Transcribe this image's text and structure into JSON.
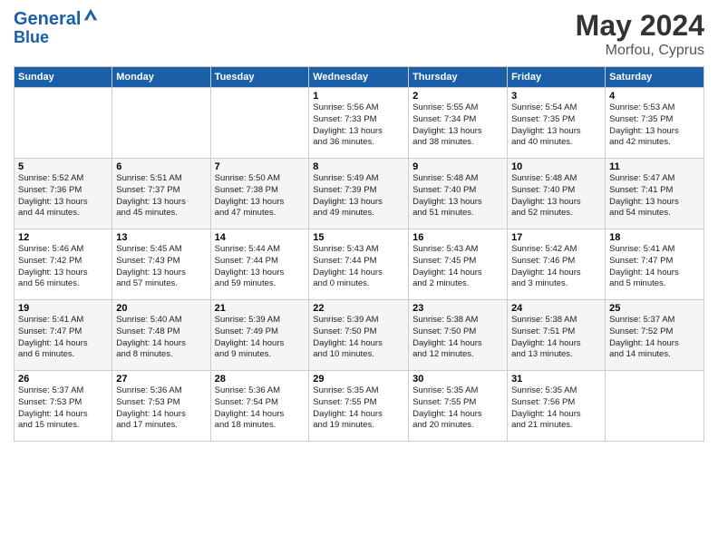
{
  "header": {
    "logo_line1": "General",
    "logo_line2": "Blue",
    "month_year": "May 2024",
    "location": "Morfou, Cyprus"
  },
  "days_of_week": [
    "Sunday",
    "Monday",
    "Tuesday",
    "Wednesday",
    "Thursday",
    "Friday",
    "Saturday"
  ],
  "weeks": [
    [
      {
        "day": "",
        "info": ""
      },
      {
        "day": "",
        "info": ""
      },
      {
        "day": "",
        "info": ""
      },
      {
        "day": "1",
        "info": "Sunrise: 5:56 AM\nSunset: 7:33 PM\nDaylight: 13 hours\nand 36 minutes."
      },
      {
        "day": "2",
        "info": "Sunrise: 5:55 AM\nSunset: 7:34 PM\nDaylight: 13 hours\nand 38 minutes."
      },
      {
        "day": "3",
        "info": "Sunrise: 5:54 AM\nSunset: 7:35 PM\nDaylight: 13 hours\nand 40 minutes."
      },
      {
        "day": "4",
        "info": "Sunrise: 5:53 AM\nSunset: 7:35 PM\nDaylight: 13 hours\nand 42 minutes."
      }
    ],
    [
      {
        "day": "5",
        "info": "Sunrise: 5:52 AM\nSunset: 7:36 PM\nDaylight: 13 hours\nand 44 minutes."
      },
      {
        "day": "6",
        "info": "Sunrise: 5:51 AM\nSunset: 7:37 PM\nDaylight: 13 hours\nand 45 minutes."
      },
      {
        "day": "7",
        "info": "Sunrise: 5:50 AM\nSunset: 7:38 PM\nDaylight: 13 hours\nand 47 minutes."
      },
      {
        "day": "8",
        "info": "Sunrise: 5:49 AM\nSunset: 7:39 PM\nDaylight: 13 hours\nand 49 minutes."
      },
      {
        "day": "9",
        "info": "Sunrise: 5:48 AM\nSunset: 7:40 PM\nDaylight: 13 hours\nand 51 minutes."
      },
      {
        "day": "10",
        "info": "Sunrise: 5:48 AM\nSunset: 7:40 PM\nDaylight: 13 hours\nand 52 minutes."
      },
      {
        "day": "11",
        "info": "Sunrise: 5:47 AM\nSunset: 7:41 PM\nDaylight: 13 hours\nand 54 minutes."
      }
    ],
    [
      {
        "day": "12",
        "info": "Sunrise: 5:46 AM\nSunset: 7:42 PM\nDaylight: 13 hours\nand 56 minutes."
      },
      {
        "day": "13",
        "info": "Sunrise: 5:45 AM\nSunset: 7:43 PM\nDaylight: 13 hours\nand 57 minutes."
      },
      {
        "day": "14",
        "info": "Sunrise: 5:44 AM\nSunset: 7:44 PM\nDaylight: 13 hours\nand 59 minutes."
      },
      {
        "day": "15",
        "info": "Sunrise: 5:43 AM\nSunset: 7:44 PM\nDaylight: 14 hours\nand 0 minutes."
      },
      {
        "day": "16",
        "info": "Sunrise: 5:43 AM\nSunset: 7:45 PM\nDaylight: 14 hours\nand 2 minutes."
      },
      {
        "day": "17",
        "info": "Sunrise: 5:42 AM\nSunset: 7:46 PM\nDaylight: 14 hours\nand 3 minutes."
      },
      {
        "day": "18",
        "info": "Sunrise: 5:41 AM\nSunset: 7:47 PM\nDaylight: 14 hours\nand 5 minutes."
      }
    ],
    [
      {
        "day": "19",
        "info": "Sunrise: 5:41 AM\nSunset: 7:47 PM\nDaylight: 14 hours\nand 6 minutes."
      },
      {
        "day": "20",
        "info": "Sunrise: 5:40 AM\nSunset: 7:48 PM\nDaylight: 14 hours\nand 8 minutes."
      },
      {
        "day": "21",
        "info": "Sunrise: 5:39 AM\nSunset: 7:49 PM\nDaylight: 14 hours\nand 9 minutes."
      },
      {
        "day": "22",
        "info": "Sunrise: 5:39 AM\nSunset: 7:50 PM\nDaylight: 14 hours\nand 10 minutes."
      },
      {
        "day": "23",
        "info": "Sunrise: 5:38 AM\nSunset: 7:50 PM\nDaylight: 14 hours\nand 12 minutes."
      },
      {
        "day": "24",
        "info": "Sunrise: 5:38 AM\nSunset: 7:51 PM\nDaylight: 14 hours\nand 13 minutes."
      },
      {
        "day": "25",
        "info": "Sunrise: 5:37 AM\nSunset: 7:52 PM\nDaylight: 14 hours\nand 14 minutes."
      }
    ],
    [
      {
        "day": "26",
        "info": "Sunrise: 5:37 AM\nSunset: 7:53 PM\nDaylight: 14 hours\nand 15 minutes."
      },
      {
        "day": "27",
        "info": "Sunrise: 5:36 AM\nSunset: 7:53 PM\nDaylight: 14 hours\nand 17 minutes."
      },
      {
        "day": "28",
        "info": "Sunrise: 5:36 AM\nSunset: 7:54 PM\nDaylight: 14 hours\nand 18 minutes."
      },
      {
        "day": "29",
        "info": "Sunrise: 5:35 AM\nSunset: 7:55 PM\nDaylight: 14 hours\nand 19 minutes."
      },
      {
        "day": "30",
        "info": "Sunrise: 5:35 AM\nSunset: 7:55 PM\nDaylight: 14 hours\nand 20 minutes."
      },
      {
        "day": "31",
        "info": "Sunrise: 5:35 AM\nSunset: 7:56 PM\nDaylight: 14 hours\nand 21 minutes."
      },
      {
        "day": "",
        "info": ""
      }
    ]
  ]
}
